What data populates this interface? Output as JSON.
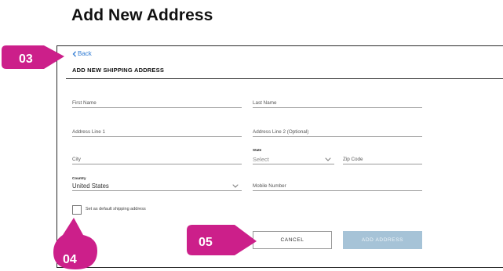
{
  "page": {
    "title": "Add New Address"
  },
  "nav": {
    "back_label": "Back"
  },
  "form": {
    "section_title": "ADD NEW SHIPPING ADDRESS",
    "first_name": {
      "label": "First Name"
    },
    "last_name": {
      "label": "Last Name"
    },
    "address_line1": {
      "label": "Address Line 1"
    },
    "address_line2": {
      "label": "Address Line 2 (Optional)"
    },
    "city": {
      "label": "City"
    },
    "state": {
      "label": "State",
      "value": "Select"
    },
    "zip": {
      "label": "Zip Code"
    },
    "country": {
      "label": "Country",
      "value": "United States"
    },
    "mobile": {
      "label": "Mobile Number"
    },
    "default_checkbox": {
      "label": "Set as default shipping address",
      "checked": false
    }
  },
  "buttons": {
    "cancel": "CANCEL",
    "add": "ADD ADDRESS"
  },
  "callouts": {
    "back": "03",
    "checkbox": "04",
    "buttons": "05"
  },
  "colors": {
    "callout": "#cc1f8a",
    "link": "#2f7bd3",
    "add_button": "#a6c3d7"
  },
  "icons": {
    "back": "chevron-left-icon",
    "dropdown": "chevron-down-icon"
  }
}
